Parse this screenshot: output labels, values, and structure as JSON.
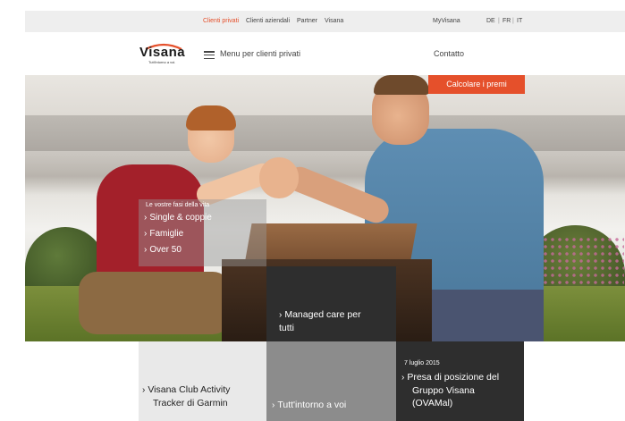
{
  "topbar": {
    "clienti_privati": "Clienti privati",
    "clienti_aziendali": "Clienti aziendali",
    "partner": "Partner",
    "visana": "Visana",
    "myvisana": "MyVisana",
    "lang_de": "DE",
    "lang_fr": "FR",
    "lang_it": "IT",
    "sep": "|"
  },
  "header": {
    "logo": "Visana",
    "logo_tagline": "Tutt'intorno a voi.",
    "menu_label": "Menu per clienti privati",
    "contact": "Contatto"
  },
  "hero": {
    "cta_label": "Calcolare i premi",
    "life_stages_title": "Le vostre fasi della vita",
    "life_stages": [
      "Single & coppie",
      "Famiglie",
      "Over 50"
    ]
  },
  "tiles": {
    "managed_care": [
      "Managed care per",
      "tutti"
    ],
    "activity": [
      "Visana Club Activity",
      "Tracker di Garmin"
    ],
    "tutt": "Tutt'intorno a voi",
    "news_date": "7 luglio 2015",
    "news": [
      "Presa di posizione del",
      "Gruppo Visana",
      "(OVAMal)"
    ]
  },
  "colors": {
    "accent": "#e5502b",
    "dark_tile": "#2e2e2e",
    "grey_tile": "#8c8c8c",
    "light_tile": "#e9e9e9"
  },
  "icons": [
    "hamburger-icon",
    "chevron-right-icon"
  ]
}
